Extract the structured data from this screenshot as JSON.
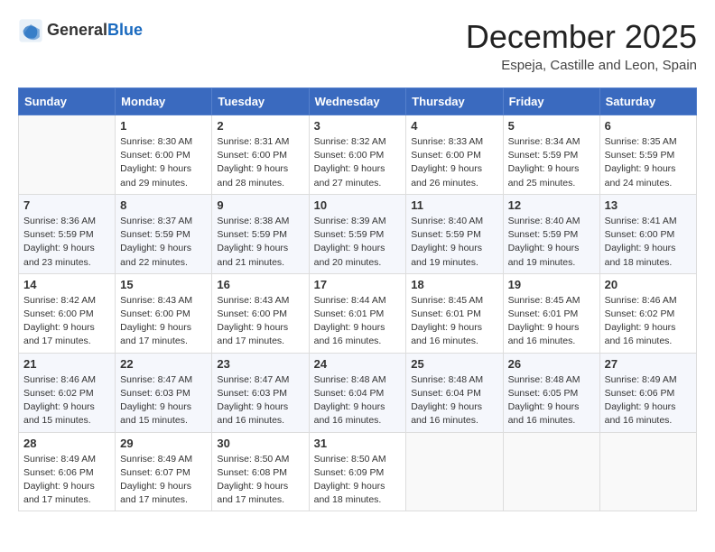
{
  "header": {
    "logo_general": "General",
    "logo_blue": "Blue",
    "month_title": "December 2025",
    "location": "Espeja, Castille and Leon, Spain"
  },
  "weekdays": [
    "Sunday",
    "Monday",
    "Tuesday",
    "Wednesday",
    "Thursday",
    "Friday",
    "Saturday"
  ],
  "weeks": [
    [
      {
        "day": "",
        "sunrise": "",
        "sunset": "",
        "daylight": ""
      },
      {
        "day": "1",
        "sunrise": "8:30 AM",
        "sunset": "6:00 PM",
        "daylight": "9 hours and 29 minutes."
      },
      {
        "day": "2",
        "sunrise": "8:31 AM",
        "sunset": "6:00 PM",
        "daylight": "9 hours and 28 minutes."
      },
      {
        "day": "3",
        "sunrise": "8:32 AM",
        "sunset": "6:00 PM",
        "daylight": "9 hours and 27 minutes."
      },
      {
        "day": "4",
        "sunrise": "8:33 AM",
        "sunset": "6:00 PM",
        "daylight": "9 hours and 26 minutes."
      },
      {
        "day": "5",
        "sunrise": "8:34 AM",
        "sunset": "5:59 PM",
        "daylight": "9 hours and 25 minutes."
      },
      {
        "day": "6",
        "sunrise": "8:35 AM",
        "sunset": "5:59 PM",
        "daylight": "9 hours and 24 minutes."
      }
    ],
    [
      {
        "day": "7",
        "sunrise": "8:36 AM",
        "sunset": "5:59 PM",
        "daylight": "9 hours and 23 minutes."
      },
      {
        "day": "8",
        "sunrise": "8:37 AM",
        "sunset": "5:59 PM",
        "daylight": "9 hours and 22 minutes."
      },
      {
        "day": "9",
        "sunrise": "8:38 AM",
        "sunset": "5:59 PM",
        "daylight": "9 hours and 21 minutes."
      },
      {
        "day": "10",
        "sunrise": "8:39 AM",
        "sunset": "5:59 PM",
        "daylight": "9 hours and 20 minutes."
      },
      {
        "day": "11",
        "sunrise": "8:40 AM",
        "sunset": "5:59 PM",
        "daylight": "9 hours and 19 minutes."
      },
      {
        "day": "12",
        "sunrise": "8:40 AM",
        "sunset": "5:59 PM",
        "daylight": "9 hours and 19 minutes."
      },
      {
        "day": "13",
        "sunrise": "8:41 AM",
        "sunset": "6:00 PM",
        "daylight": "9 hours and 18 minutes."
      }
    ],
    [
      {
        "day": "14",
        "sunrise": "8:42 AM",
        "sunset": "6:00 PM",
        "daylight": "9 hours and 17 minutes."
      },
      {
        "day": "15",
        "sunrise": "8:43 AM",
        "sunset": "6:00 PM",
        "daylight": "9 hours and 17 minutes."
      },
      {
        "day": "16",
        "sunrise": "8:43 AM",
        "sunset": "6:00 PM",
        "daylight": "9 hours and 17 minutes."
      },
      {
        "day": "17",
        "sunrise": "8:44 AM",
        "sunset": "6:01 PM",
        "daylight": "9 hours and 16 minutes."
      },
      {
        "day": "18",
        "sunrise": "8:45 AM",
        "sunset": "6:01 PM",
        "daylight": "9 hours and 16 minutes."
      },
      {
        "day": "19",
        "sunrise": "8:45 AM",
        "sunset": "6:01 PM",
        "daylight": "9 hours and 16 minutes."
      },
      {
        "day": "20",
        "sunrise": "8:46 AM",
        "sunset": "6:02 PM",
        "daylight": "9 hours and 16 minutes."
      }
    ],
    [
      {
        "day": "21",
        "sunrise": "8:46 AM",
        "sunset": "6:02 PM",
        "daylight": "9 hours and 15 minutes."
      },
      {
        "day": "22",
        "sunrise": "8:47 AM",
        "sunset": "6:03 PM",
        "daylight": "9 hours and 15 minutes."
      },
      {
        "day": "23",
        "sunrise": "8:47 AM",
        "sunset": "6:03 PM",
        "daylight": "9 hours and 16 minutes."
      },
      {
        "day": "24",
        "sunrise": "8:48 AM",
        "sunset": "6:04 PM",
        "daylight": "9 hours and 16 minutes."
      },
      {
        "day": "25",
        "sunrise": "8:48 AM",
        "sunset": "6:04 PM",
        "daylight": "9 hours and 16 minutes."
      },
      {
        "day": "26",
        "sunrise": "8:48 AM",
        "sunset": "6:05 PM",
        "daylight": "9 hours and 16 minutes."
      },
      {
        "day": "27",
        "sunrise": "8:49 AM",
        "sunset": "6:06 PM",
        "daylight": "9 hours and 16 minutes."
      }
    ],
    [
      {
        "day": "28",
        "sunrise": "8:49 AM",
        "sunset": "6:06 PM",
        "daylight": "9 hours and 17 minutes."
      },
      {
        "day": "29",
        "sunrise": "8:49 AM",
        "sunset": "6:07 PM",
        "daylight": "9 hours and 17 minutes."
      },
      {
        "day": "30",
        "sunrise": "8:50 AM",
        "sunset": "6:08 PM",
        "daylight": "9 hours and 17 minutes."
      },
      {
        "day": "31",
        "sunrise": "8:50 AM",
        "sunset": "6:09 PM",
        "daylight": "9 hours and 18 minutes."
      },
      {
        "day": "",
        "sunrise": "",
        "sunset": "",
        "daylight": ""
      },
      {
        "day": "",
        "sunrise": "",
        "sunset": "",
        "daylight": ""
      },
      {
        "day": "",
        "sunrise": "",
        "sunset": "",
        "daylight": ""
      }
    ]
  ]
}
